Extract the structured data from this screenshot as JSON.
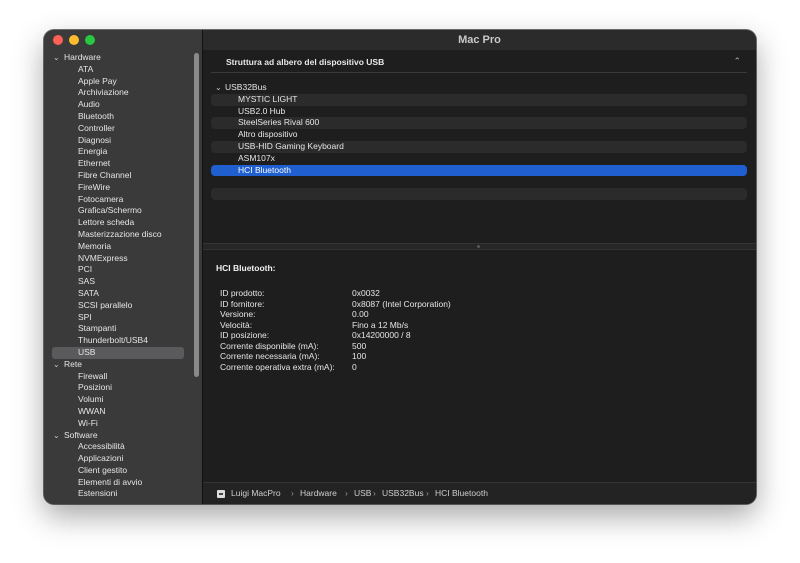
{
  "window": {
    "title": "Mac Pro"
  },
  "sidebar": {
    "rows": [
      {
        "label": "Hardware",
        "kind": "group"
      },
      {
        "label": "ATA",
        "kind": "item"
      },
      {
        "label": "Apple Pay",
        "kind": "item"
      },
      {
        "label": "Archiviazione",
        "kind": "item"
      },
      {
        "label": "Audio",
        "kind": "item"
      },
      {
        "label": "Bluetooth",
        "kind": "item"
      },
      {
        "label": "Controller",
        "kind": "item"
      },
      {
        "label": "Diagnosi",
        "kind": "item"
      },
      {
        "label": "Energia",
        "kind": "item"
      },
      {
        "label": "Ethernet",
        "kind": "item"
      },
      {
        "label": "Fibre Channel",
        "kind": "item"
      },
      {
        "label": "FireWire",
        "kind": "item"
      },
      {
        "label": "Fotocamera",
        "kind": "item"
      },
      {
        "label": "Grafica/Schermo",
        "kind": "item"
      },
      {
        "label": "Lettore scheda",
        "kind": "item"
      },
      {
        "label": "Masterizzazione disco",
        "kind": "item"
      },
      {
        "label": "Memoria",
        "kind": "item"
      },
      {
        "label": "NVMExpress",
        "kind": "item"
      },
      {
        "label": "PCI",
        "kind": "item"
      },
      {
        "label": "SAS",
        "kind": "item"
      },
      {
        "label": "SATA",
        "kind": "item"
      },
      {
        "label": "SCSI parallelo",
        "kind": "item"
      },
      {
        "label": "SPI",
        "kind": "item"
      },
      {
        "label": "Stampanti",
        "kind": "item"
      },
      {
        "label": "Thunderbolt/USB4",
        "kind": "item"
      },
      {
        "label": "USB",
        "kind": "item",
        "selected": true
      },
      {
        "label": "Rete",
        "kind": "group"
      },
      {
        "label": "Firewall",
        "kind": "item"
      },
      {
        "label": "Posizioni",
        "kind": "item"
      },
      {
        "label": "Volumi",
        "kind": "item"
      },
      {
        "label": "WWAN",
        "kind": "item"
      },
      {
        "label": "Wi-Fi",
        "kind": "item"
      },
      {
        "label": "Software",
        "kind": "group"
      },
      {
        "label": "Accessibilità",
        "kind": "item"
      },
      {
        "label": "Applicazioni",
        "kind": "item"
      },
      {
        "label": "Client gestito",
        "kind": "item"
      },
      {
        "label": "Elementi di avvio",
        "kind": "item"
      },
      {
        "label": "Estensioni",
        "kind": "item"
      }
    ]
  },
  "tree": {
    "header": "Struttura ad albero del dispositivo USB",
    "rows": [
      {
        "label": "USB32Bus",
        "kind": "root"
      },
      {
        "label": "MYSTIC LIGHT",
        "kind": "child"
      },
      {
        "label": "USB2.0 Hub",
        "kind": "child"
      },
      {
        "label": "SteelSeries Rival 600",
        "kind": "child"
      },
      {
        "label": "Altro dispositivo",
        "kind": "child"
      },
      {
        "label": "USB-HID Gaming Keyboard",
        "kind": "child"
      },
      {
        "label": "ASM107x",
        "kind": "child"
      },
      {
        "label": "HCI Bluetooth",
        "kind": "child",
        "selected": true
      },
      {
        "label": "",
        "kind": "child"
      },
      {
        "label": "",
        "kind": "child"
      },
      {
        "label": "",
        "kind": "child"
      }
    ]
  },
  "details": {
    "title": "HCI Bluetooth:",
    "properties": [
      {
        "key": "ID prodotto:",
        "value": "0x0032"
      },
      {
        "key": "ID fornitore:",
        "value": "0x8087  (Intel Corporation)"
      },
      {
        "key": "Versione:",
        "value": "0.00"
      },
      {
        "key": "Velocità:",
        "value": "Fino a 12 Mb/s"
      },
      {
        "key": "ID posizione:",
        "value": "0x14200000 / 8"
      },
      {
        "key": "Corrente disponibile (mA):",
        "value": "500"
      },
      {
        "key": "Corrente necessaria (mA):",
        "value": "100"
      },
      {
        "key": "Corrente operativa extra (mA):",
        "value": "0"
      }
    ]
  },
  "pathbar": {
    "items": [
      "Luigi MacPro",
      "Hardware",
      "USB",
      "USB32Bus",
      "HCI Bluetooth"
    ],
    "separator": "›"
  },
  "colors": {
    "selection": "#1f5fd0",
    "close": "#fe5f57",
    "minimize": "#febc2e",
    "zoom": "#28c840"
  }
}
